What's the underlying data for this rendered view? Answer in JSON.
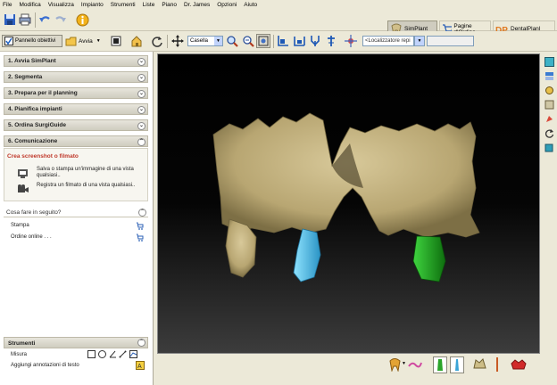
{
  "menu": [
    "File",
    "Modifica",
    "Visualizza",
    "Impianto",
    "Strumenti",
    "Liste",
    "Piano",
    "Dr. James",
    "Opzioni",
    "Aiuto"
  ],
  "tabs": {
    "simplant": "SimPlant",
    "pagine": "Pagine d'Ordine",
    "dental": "DentalPlanl"
  },
  "toolbar": {
    "pannello": "Pannello obiettivi",
    "avvia": "Avvia",
    "casella": "Casella",
    "localizzatore": "<Localizzatore repi"
  },
  "sections": [
    {
      "label": "1. Avvia SimPlant",
      "state": "collapsed"
    },
    {
      "label": "2. Segmenta",
      "state": "collapsed"
    },
    {
      "label": "3. Prepara per il planning",
      "state": "collapsed"
    },
    {
      "label": "4. Pianifica impianti",
      "state": "collapsed"
    },
    {
      "label": "5. Ordina SurgiGuide",
      "state": "collapsed"
    },
    {
      "label": "6. Comunicazione",
      "state": "expanded"
    }
  ],
  "communication": {
    "title": "Crea screenshot o filmato",
    "item1": "Salva o stampa un'immagine di una vista qualsiasi..",
    "item2": "Registra un filmato di una vista qualsiasi.."
  },
  "next": {
    "title": "Cosa fare in seguito?",
    "stampa": "Stampa",
    "ordine": "Ordine online . . ."
  },
  "strumenti": {
    "title": "Strumenti",
    "misura": "Misura",
    "annot": "Aggiungi annotazioni di testo"
  },
  "colors": {
    "bone": "#c9b782",
    "implant_left": "#4fc3e6",
    "implant_right": "#1fa31f"
  }
}
